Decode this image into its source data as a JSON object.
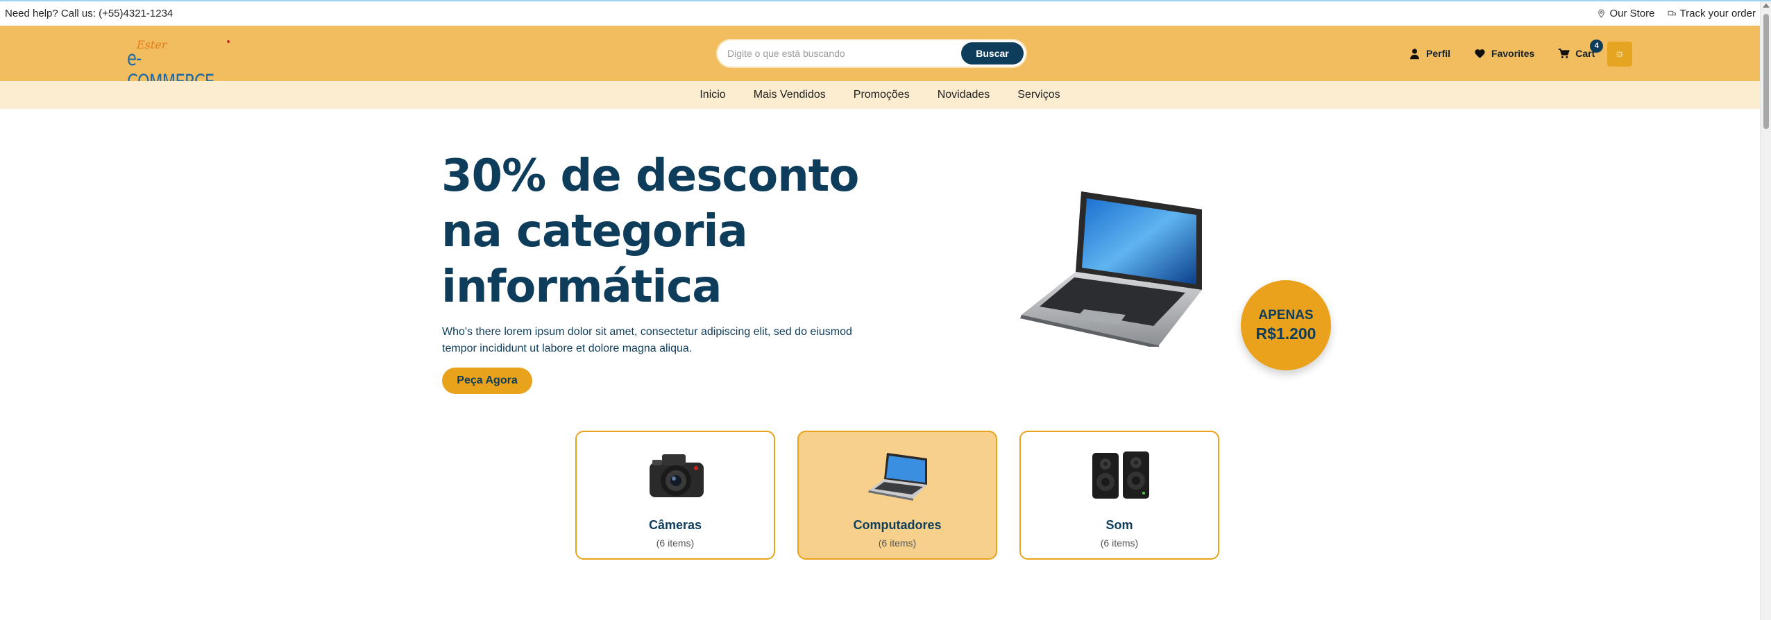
{
  "topbar": {
    "help_text": "Need help? Call us: (+55)4321-1234",
    "store_link": "Our Store",
    "track_link": "Track your order"
  },
  "header": {
    "logo_script": "Ester",
    "logo_word": "e-COMMERCE",
    "search_placeholder": "Digite o que está buscando",
    "search_button": "Buscar",
    "profile_label": "Perfil",
    "favorites_label": "Favorites",
    "cart_label": "Cart",
    "cart_count": "4",
    "theme_icon": "sun-icon"
  },
  "nav": {
    "items": [
      "Inicio",
      "Mais Vendidos",
      "Promoções",
      "Novidades",
      "Serviços"
    ]
  },
  "hero": {
    "title_lines": [
      "30% de desconto",
      "na categoria",
      "informática"
    ],
    "description": "Who's there lorem ipsum dolor sit amet, consectetur adipiscing elit, sed do eiusmod tempor incididunt ut labore et dolore magna aliqua.",
    "cta_label": "Peça Agora",
    "price_label": "APENAS",
    "price_value": "R$1.200"
  },
  "categories": [
    {
      "name": "Câmeras",
      "count": "(6 items)",
      "icon": "camera-icon",
      "active": false
    },
    {
      "name": "Computadores",
      "count": "(6 items)",
      "icon": "laptop-icon",
      "active": true
    },
    {
      "name": "Som",
      "count": "(6 items)",
      "icon": "speakers-icon",
      "active": false
    }
  ],
  "colors": {
    "header_bg": "#f2bd5e",
    "nav_bg": "#fcedd0",
    "primary_dark": "#0e3d5c",
    "accent": "#e8a21c",
    "active_card": "#f7d18c"
  }
}
